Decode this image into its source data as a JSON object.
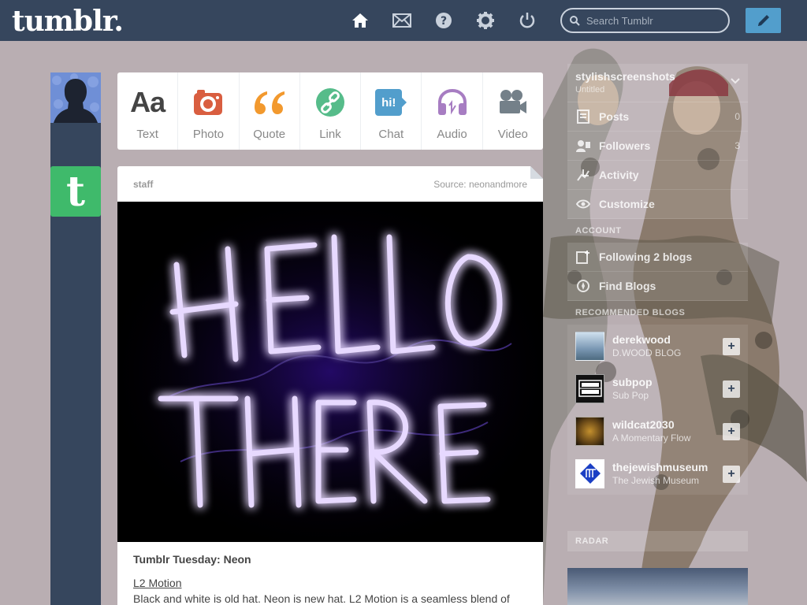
{
  "header": {
    "logo": "tumblr.",
    "search_placeholder": "Search Tumblr",
    "nav_icons": [
      "home-icon",
      "mail-icon",
      "help-icon",
      "gear-icon",
      "power-icon"
    ],
    "compose_icon": "pencil-icon"
  },
  "post_types": [
    {
      "label": "Text",
      "icon": "Aa",
      "color": "#444444"
    },
    {
      "label": "Photo",
      "icon": "camera-icon",
      "color": "#d95e40"
    },
    {
      "label": "Quote",
      "icon": "quote-icon",
      "color": "#f2992e"
    },
    {
      "label": "Link",
      "icon": "link-icon",
      "color": "#56bc8a"
    },
    {
      "label": "Chat",
      "icon": "hi!",
      "color": "#529ecc"
    },
    {
      "label": "Audio",
      "icon": "headphones-icon",
      "color": "#a77dc2"
    },
    {
      "label": "Video",
      "icon": "video-camera-icon",
      "color": "#748089"
    }
  ],
  "post": {
    "author": "staff",
    "source": "Source: neonandmore",
    "image_text": [
      "HELLO",
      "THERE"
    ],
    "title": "Tumblr Tuesday: Neon",
    "link": "L2 Motion",
    "body": "Black and white is old hat. Neon is new hat. L2 Motion is a seamless blend of"
  },
  "sidebar": {
    "blog_name": "stylishscreenshots",
    "blog_sub": "Untitled",
    "items": [
      {
        "label": "Posts",
        "count": "0",
        "icon": "posts-icon"
      },
      {
        "label": "Followers",
        "count": "3",
        "icon": "followers-icon"
      },
      {
        "label": "Activity",
        "count": "",
        "icon": "activity-icon"
      },
      {
        "label": "Customize",
        "count": "",
        "icon": "eye-icon"
      }
    ],
    "account_heading": "ACCOUNT",
    "account_items": [
      {
        "label": "Following 2 blogs",
        "icon": "following-icon"
      },
      {
        "label": "Find Blogs",
        "icon": "compass-icon"
      }
    ],
    "recommended_heading": "RECOMMENDED BLOGS",
    "recommended": [
      {
        "name": "derekwood",
        "sub": "D.WOOD BLOG",
        "avatar_color": "#7a97b3"
      },
      {
        "name": "subpop",
        "sub": "Sub Pop",
        "avatar_color": "#111111"
      },
      {
        "name": "wildcat2030",
        "sub": "A Momentary Flow",
        "avatar_color": "#3a2a10"
      },
      {
        "name": "thejewishmuseum",
        "sub": "The Jewish Museum",
        "avatar_color": "#ffffff"
      }
    ],
    "radar_heading": "RADAR"
  },
  "colors": {
    "header_bg": "#36465d",
    "page_bg": "#b9aeb2",
    "compose_bg": "#529ecc",
    "staff_avatar": "#3fba6b"
  }
}
